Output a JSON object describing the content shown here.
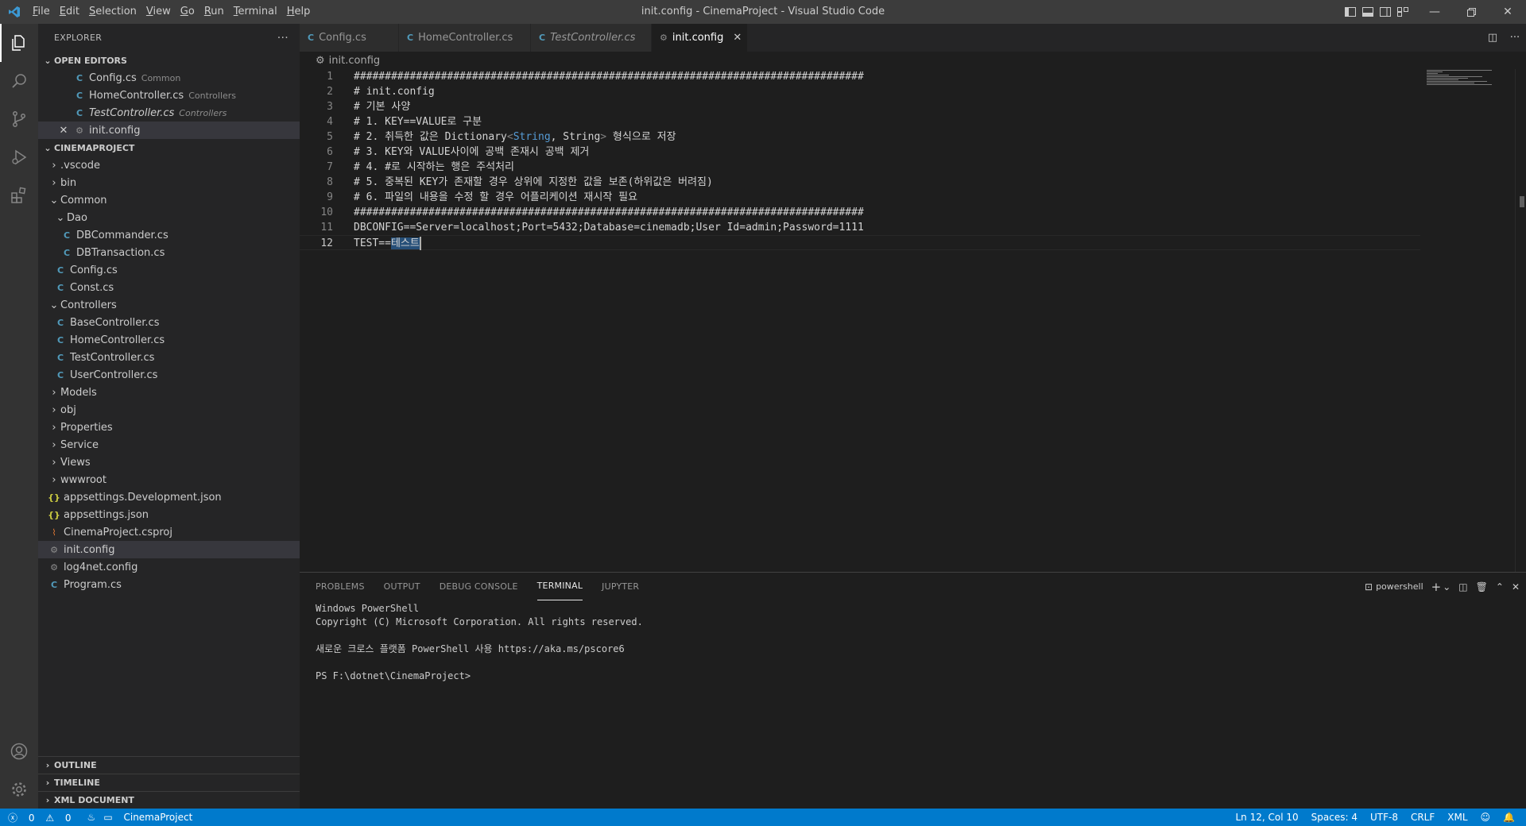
{
  "window": {
    "title": "init.config - CinemaProject - Visual Studio Code",
    "menu": [
      "File",
      "Edit",
      "Selection",
      "View",
      "Go",
      "Run",
      "Terminal",
      "Help"
    ]
  },
  "sidebar": {
    "title": "EXPLORER",
    "more": "···",
    "open_editors": {
      "title": "OPEN EDITORS",
      "items": [
        {
          "name": "Config.cs",
          "desc": "Common"
        },
        {
          "name": "HomeController.cs",
          "desc": "Controllers"
        },
        {
          "name": "TestController.cs",
          "desc": "Controllers"
        },
        {
          "name": "init.config",
          "desc": ""
        }
      ]
    },
    "project": {
      "title": "CINEMAPROJECT",
      "items": [
        ".vscode",
        "bin",
        "Common",
        "Dao",
        "DBCommander.cs",
        "DBTransaction.cs",
        "Config.cs",
        "Const.cs",
        "Controllers",
        "BaseController.cs",
        "HomeController.cs",
        "TestController.cs",
        "UserController.cs",
        "Models",
        "obj",
        "Properties",
        "Service",
        "Views",
        "wwwroot",
        "appsettings.Development.json",
        "appsettings.json",
        "CinemaProject.csproj",
        "init.config",
        "log4net.config",
        "Program.cs"
      ]
    },
    "bottom_sections": [
      "OUTLINE",
      "TIMELINE",
      "XML DOCUMENT"
    ]
  },
  "tabs": [
    {
      "label": "Config.cs"
    },
    {
      "label": "HomeController.cs"
    },
    {
      "label": "TestController.cs"
    },
    {
      "label": "init.config"
    }
  ],
  "breadcrumb": "init.config",
  "editor": {
    "line_numbers": [
      "1",
      "2",
      "3",
      "4",
      "5",
      "6",
      "7",
      "8",
      "9",
      "10",
      "11",
      "12"
    ],
    "lines": [
      "##################################################################################",
      "# init.config",
      "# 기본 사양",
      "# 1. KEY==VALUE로 구분",
      "# 2. 취득한 값은 Dictionary<String, String> 형식으로 저장",
      "# 3. KEY와 VALUE사이에 공백 존재시 공백 제거",
      "# 4. #로 시작하는 행은 주석처리",
      "# 5. 중복된 KEY가 존재할 경우 상위에 지정한 값을 보존(하위값은 버려짐)",
      "# 6. 파일의 내용을 수정 할 경우 어플리케이션 재시작 필요",
      "##################################################################################",
      "DBCONFIG==Server=localhost;Port=5432;Database=cinemadb;User Id=admin;Password=1111",
      "TEST==테스트"
    ],
    "line5_parts": [
      "# 2. 취득한 값은 Dictionary",
      "<",
      "String",
      ", String",
      ">",
      " 형식으로 저장"
    ],
    "line12_parts": [
      "TEST==",
      "테스트"
    ]
  },
  "panel": {
    "tabs": [
      "PROBLEMS",
      "OUTPUT",
      "DEBUG CONSOLE",
      "TERMINAL",
      "JUPYTER"
    ],
    "shell": "powershell",
    "terminal_lines": [
      "Windows PowerShell",
      "Copyright (C) Microsoft Corporation. All rights reserved.",
      "",
      "새로운 크로스 플랫폼 PowerShell 사용 https://aka.ms/pscore6",
      "",
      "PS F:\\dotnet\\CinemaProject>"
    ]
  },
  "statusbar": {
    "errors": "0",
    "warnings": "0",
    "project": "CinemaProject",
    "position": "Ln 12, Col 10",
    "spaces": "Spaces: 4",
    "encoding": "UTF-8",
    "eol": "CRLF",
    "language": "XML"
  },
  "colors": {
    "accent": "#007acc",
    "activity_bar": "#333333",
    "sidebar": "#252526",
    "editor": "#1e1e1e"
  }
}
